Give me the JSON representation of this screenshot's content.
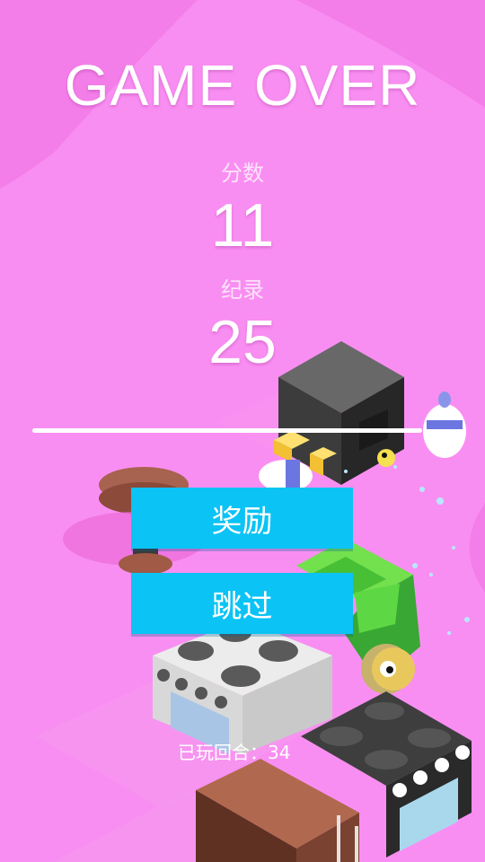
{
  "game_over": {
    "title": "GAME OVER"
  },
  "score": {
    "label": "分数",
    "value": "11"
  },
  "record": {
    "label": "纪录",
    "value": "25"
  },
  "buttons": {
    "reward": "奖励",
    "skip": "跳过"
  },
  "rounds_played": {
    "text": "已玩回合：34"
  },
  "colors": {
    "background": "#f98ef2",
    "button": "#0bc3f5",
    "text": "#ffffff"
  }
}
